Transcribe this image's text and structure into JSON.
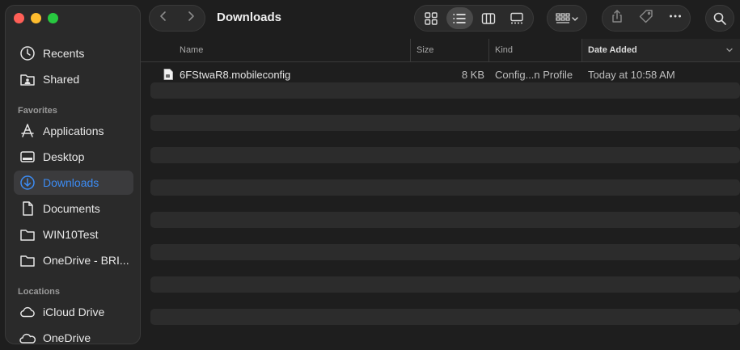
{
  "window": {
    "title": "Downloads"
  },
  "sidebar": {
    "items_top": [
      {
        "label": "Recents",
        "icon": "clock-icon"
      },
      {
        "label": "Shared",
        "icon": "shared-folder-icon"
      }
    ],
    "favorites_label": "Favorites",
    "favorites": [
      {
        "label": "Applications",
        "icon": "applications-icon"
      },
      {
        "label": "Desktop",
        "icon": "desktop-icon"
      },
      {
        "label": "Downloads",
        "icon": "download-icon",
        "active": true
      },
      {
        "label": "Documents",
        "icon": "document-icon"
      },
      {
        "label": "WIN10Test",
        "icon": "folder-icon"
      },
      {
        "label": "OneDrive - BRI...",
        "icon": "folder-icon"
      }
    ],
    "locations_label": "Locations",
    "locations": [
      {
        "label": "iCloud Drive",
        "icon": "cloud-icon"
      },
      {
        "label": "OneDrive",
        "icon": "onedrive-cloud-icon"
      }
    ]
  },
  "columns": {
    "name": "Name",
    "size": "Size",
    "kind": "Kind",
    "date_added": "Date Added"
  },
  "files": [
    {
      "name": "6FStwaR8.mobileconfig",
      "size": "8 KB",
      "kind": "Config...n Profile",
      "date_added": "Today at 10:58 AM"
    }
  ],
  "colors": {
    "accent": "#3c8cf4",
    "close": "#ff5f57",
    "minimize": "#febc2e",
    "zoom": "#28c840"
  }
}
